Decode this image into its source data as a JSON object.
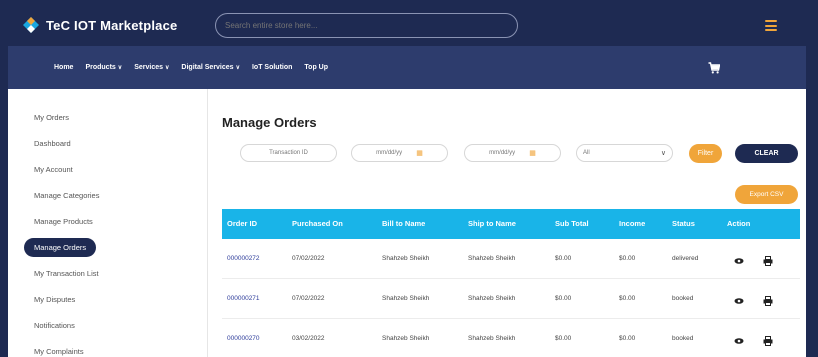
{
  "header": {
    "logo_text": "TeC IOT Marketplace",
    "search_placeholder": "Search entire store here..."
  },
  "nav": {
    "items": [
      {
        "label": "Home",
        "dropdown": false
      },
      {
        "label": "Products",
        "dropdown": true
      },
      {
        "label": "Services",
        "dropdown": true
      },
      {
        "label": "Digital Services",
        "dropdown": true
      },
      {
        "label": "IoT Solution",
        "dropdown": false
      },
      {
        "label": "Top Up",
        "dropdown": false
      }
    ]
  },
  "sidebar": {
    "items": [
      {
        "label": "My Orders"
      },
      {
        "label": "Dashboard"
      },
      {
        "label": "My Account"
      },
      {
        "label": "Manage Categories"
      },
      {
        "label": "Manage Products"
      },
      {
        "label": "Manage Orders",
        "active": true
      },
      {
        "label": "My Transaction List"
      },
      {
        "label": "My Disputes"
      },
      {
        "label": "Notifications"
      },
      {
        "label": "My Complaints"
      }
    ]
  },
  "main": {
    "title": "Manage Orders",
    "filters": {
      "transaction_placeholder": "Transaction ID",
      "date_from": "mm/dd/yy",
      "date_to": "mm/dd/yy",
      "status_value": "All"
    },
    "filter_label": "Filter",
    "clear_label": "CLEAR",
    "export_label": "Export CSV",
    "table": {
      "headers": [
        "Order ID",
        "Purchased On",
        "Bill to Name",
        "Ship to Name",
        "Sub Total",
        "Income",
        "Status",
        "Action"
      ],
      "rows": [
        {
          "order_id": "000000272",
          "purchased_on": "07/02/2022",
          "bill_to": "Shahzeb Sheikh",
          "ship_to": "Shahzeb Sheikh",
          "sub_total": "$0.00",
          "income": "$0.00",
          "status": "delivered"
        },
        {
          "order_id": "000000271",
          "purchased_on": "07/02/2022",
          "bill_to": "Shahzeb Sheikh",
          "ship_to": "Shahzeb Sheikh",
          "sub_total": "$0.00",
          "income": "$0.00",
          "status": "booked"
        },
        {
          "order_id": "000000270",
          "purchased_on": "03/02/2022",
          "bill_to": "Shahzeb Sheikh",
          "ship_to": "Shahzeb Sheikh",
          "sub_total": "$0.00",
          "income": "$0.00",
          "status": "booked"
        }
      ]
    }
  },
  "icons": {
    "view": "eye-icon",
    "print": "printer-icon",
    "cart": "cart-icon",
    "menu": "hamburger-icon",
    "calendar": "calendar-icon",
    "select": "chevron-down-icon"
  },
  "colors": {
    "header_bg": "#1e2a52",
    "nav_bg": "#2d3c6d",
    "accent": "#f0a53a",
    "table_header": "#19b4e8"
  }
}
